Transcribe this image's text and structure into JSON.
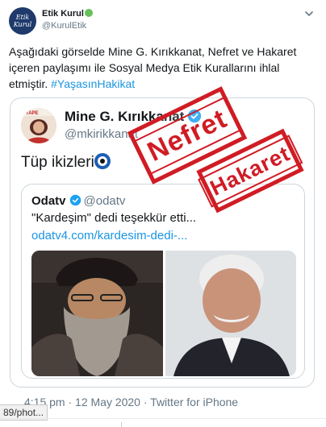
{
  "account": {
    "name": "Etik Kurul",
    "handle": "@KurulEtik",
    "avatar_text": [
      "Etik",
      "Kurul"
    ]
  },
  "tweet": {
    "text_main": "Aşağıdaki görselde Mine G. Kırıkkanat, Nefret ve Hakaret içeren paylaşımı ile Sosyal Medya Etik Kurallarını ihlal etmiştir. ",
    "hashtag": "#YaşasınHakikat",
    "meta": "4:15 pm · 12 May 2020 · Twitter for iPhone"
  },
  "quoted": {
    "name": "Mine G. Kırıkkanat",
    "handle": "@mkirikkanat",
    "text": "Tüp ikizleri",
    "avatar_label": "TAPE",
    "inner": {
      "name": "Odatv",
      "handle": "@odatv",
      "title": "\"Kardeşim\" dedi teşekkür etti...",
      "link": "odatv4.com/kardesim-dedi-..."
    }
  },
  "stamps": {
    "first": "Nefret",
    "second": "Hakaret"
  },
  "status_bar": {
    "url": "89/phot..."
  },
  "colors": {
    "link": "#1b95e0",
    "stamp": "#d01c24",
    "verified": "#1da1f2",
    "online": "#66c05a"
  }
}
